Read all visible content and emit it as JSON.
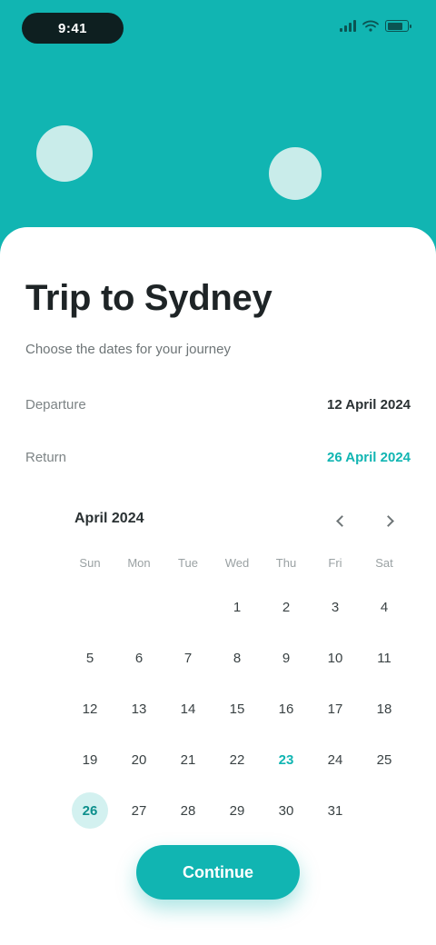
{
  "status_bar": {
    "time": "9:41"
  },
  "trip": {
    "title": "Trip to Sydney",
    "subtitle": "Choose the dates for your journey"
  },
  "details": [
    {
      "label": "Departure",
      "value": "12 April 2024",
      "accent": false
    },
    {
      "label": "Return",
      "value": "26 April 2024",
      "accent": true
    }
  ],
  "calendar": {
    "month": "April 2024",
    "weekdays": [
      "Sun",
      "Mon",
      "Tue",
      "Wed",
      "Thu",
      "Fri",
      "Sat"
    ],
    "weeks": [
      [
        "",
        "",
        "",
        "1",
        "2",
        "3",
        "4"
      ],
      [
        "5",
        "6",
        "7",
        "8",
        "9",
        "10",
        "11"
      ],
      [
        "12",
        "13",
        "14",
        "15",
        "16",
        "17",
        "18"
      ],
      [
        "19",
        "20",
        "21",
        "22",
        "23",
        "24",
        "25"
      ],
      [
        "26",
        "27",
        "28",
        "29",
        "30",
        "31",
        ""
      ]
    ],
    "today": "23",
    "selected": "26"
  },
  "cta": {
    "label": "Continue"
  },
  "colors": {
    "accent": "#11b5b2",
    "text": "#1e2426",
    "muted": "#6e7577"
  },
  "icons": {
    "prev": "chevron-left-icon",
    "next": "chevron-right-icon",
    "signal": "signal-icon",
    "wifi": "wifi-icon",
    "battery": "battery-icon"
  }
}
